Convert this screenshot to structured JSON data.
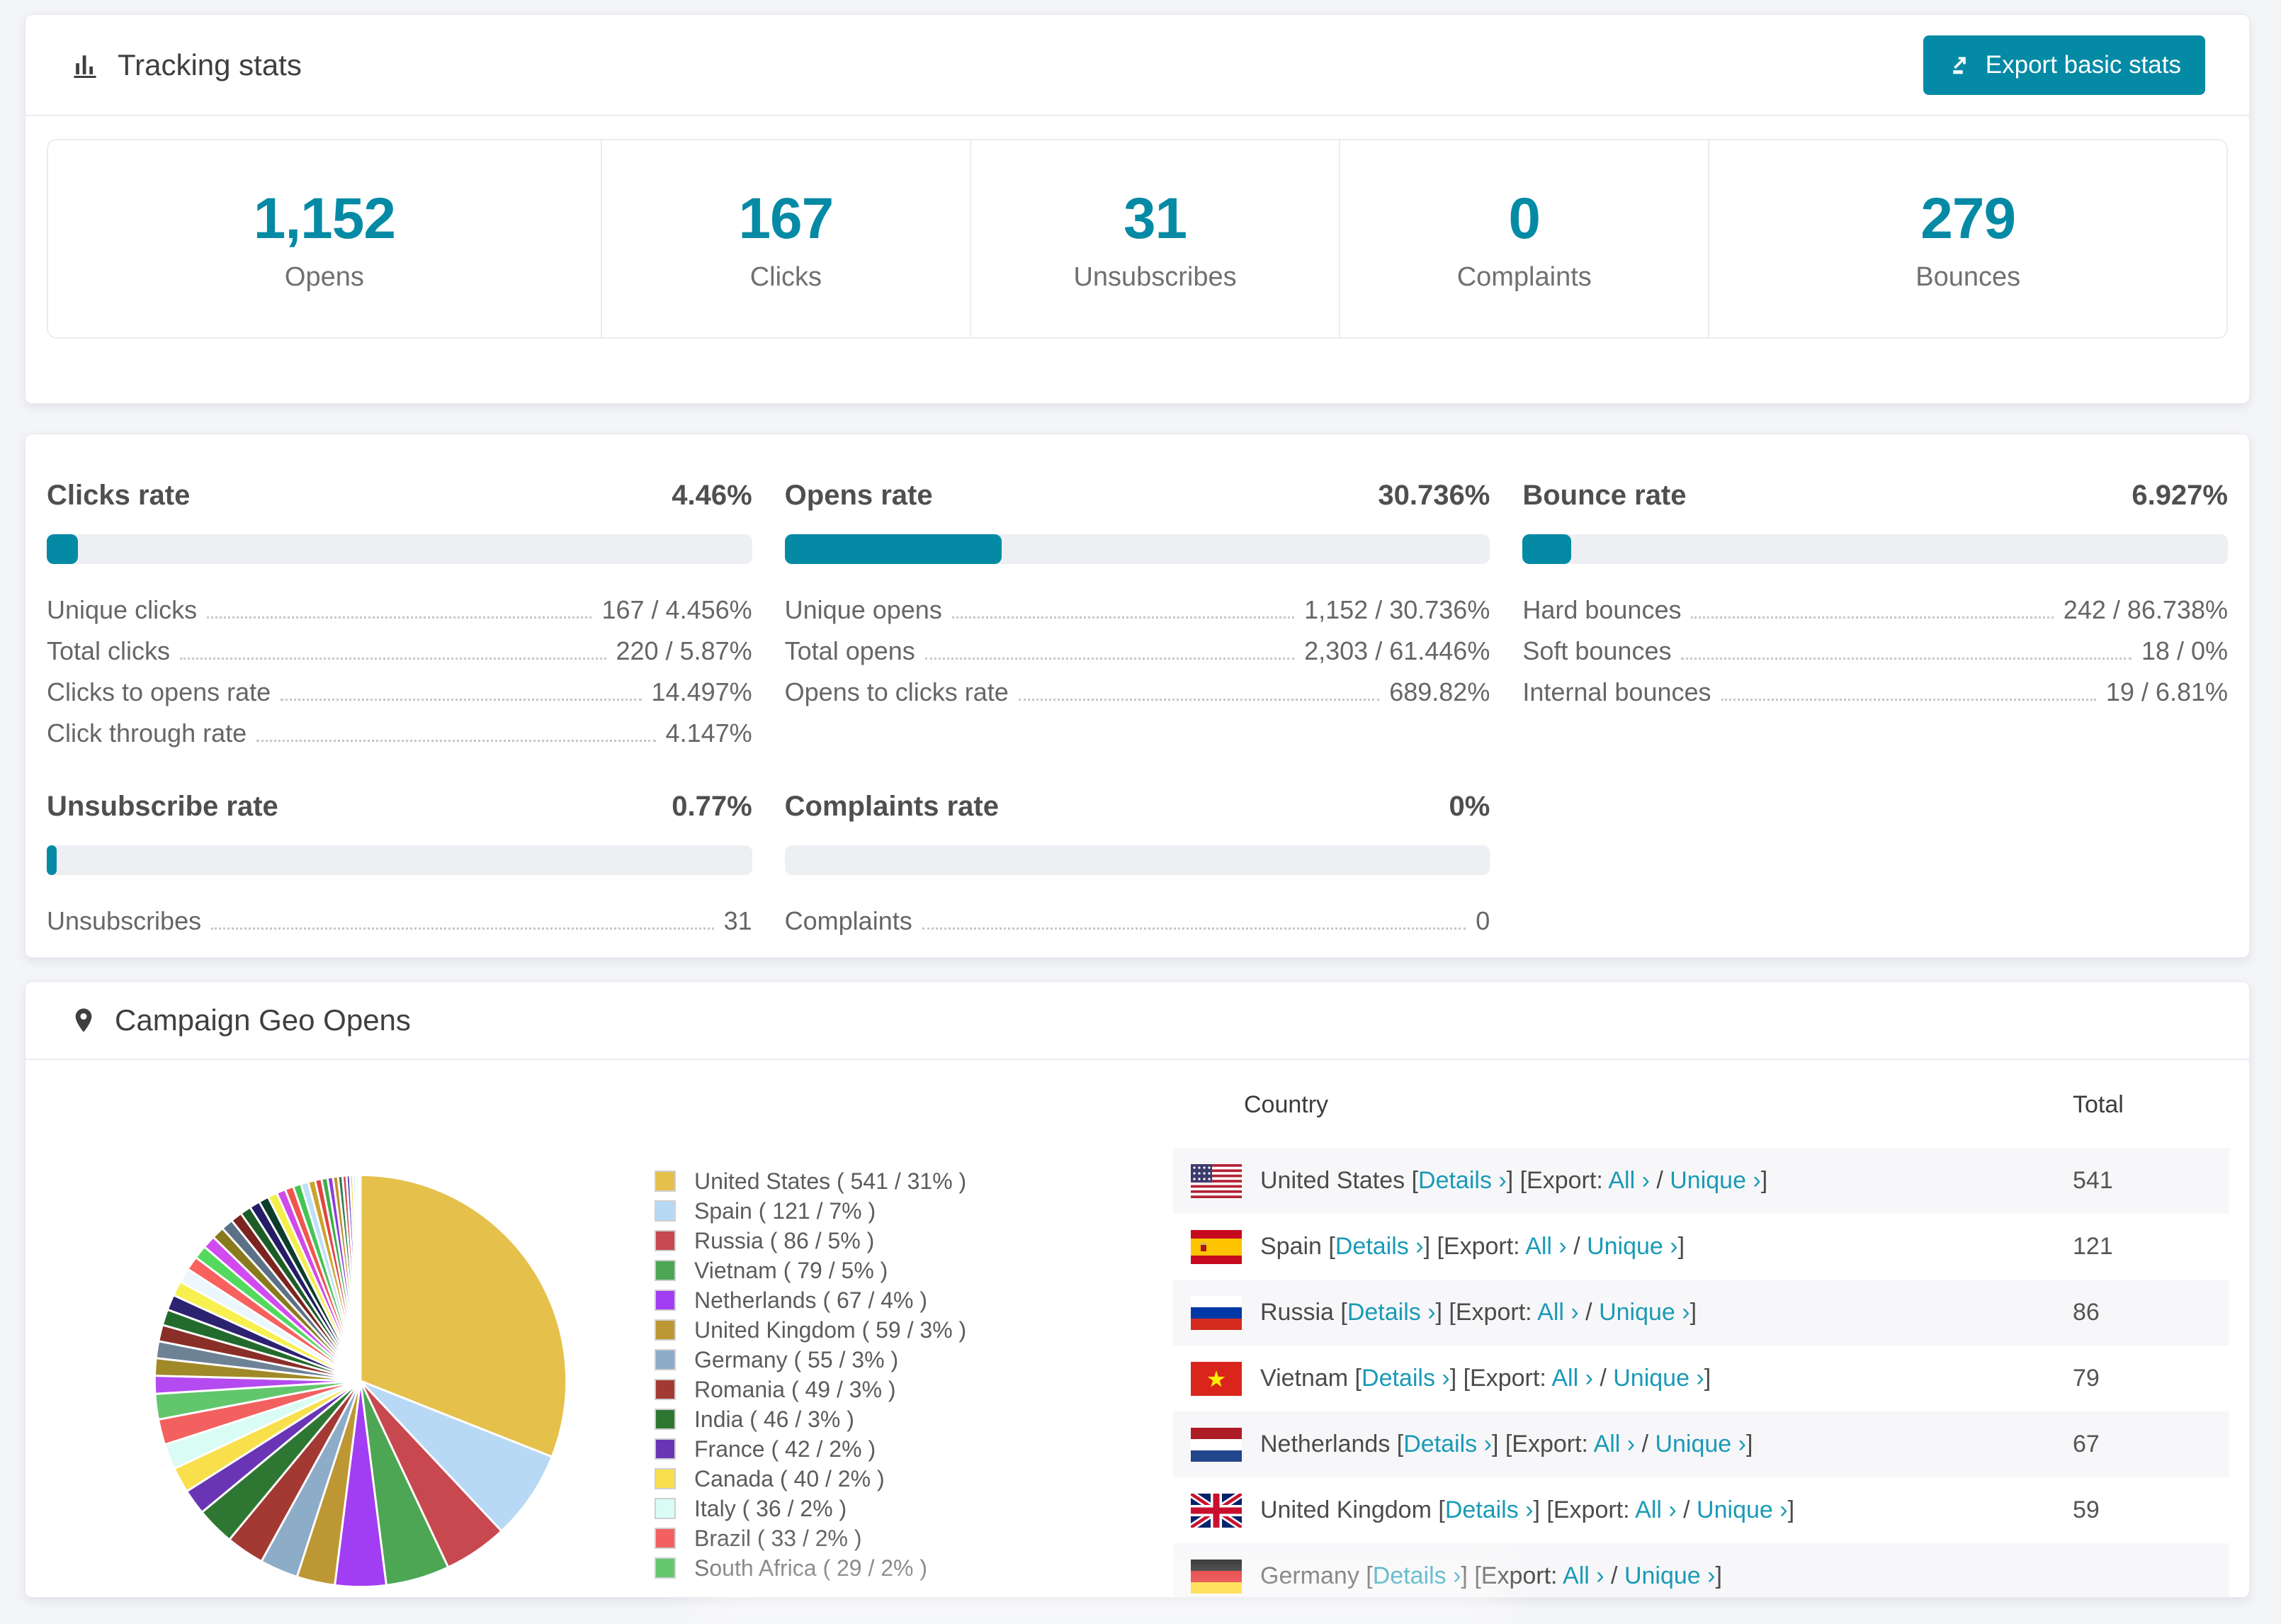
{
  "colors": {
    "accent": "#058aa5",
    "link": "#1a9ab6",
    "bar_track": "#edeff3",
    "page_background": "#f4f5f7",
    "row_stripe": "#f7f7f9"
  },
  "tracking": {
    "title": "Tracking stats",
    "export_button": "Export basic stats",
    "stats": [
      {
        "value": "1,152",
        "label": "Opens"
      },
      {
        "value": "167",
        "label": "Clicks"
      },
      {
        "value": "31",
        "label": "Unsubscribes"
      },
      {
        "value": "0",
        "label": "Complaints"
      },
      {
        "value": "279",
        "label": "Bounces"
      }
    ]
  },
  "rates": {
    "blocks": [
      {
        "title": "Clicks rate",
        "value": "4.46%",
        "pct": 4.46,
        "rows": [
          [
            "Unique clicks",
            "167 / 4.456%"
          ],
          [
            "Total clicks",
            "220 / 5.87%"
          ],
          [
            "Clicks to opens rate",
            "14.497%"
          ],
          [
            "Click through rate",
            "4.147%"
          ]
        ]
      },
      {
        "title": "Opens rate",
        "value": "30.736%",
        "pct": 30.736,
        "rows": [
          [
            "Unique opens",
            "1,152 / 30.736%"
          ],
          [
            "Total opens",
            "2,303 / 61.446%"
          ],
          [
            "Opens to clicks rate",
            "689.82%"
          ]
        ]
      },
      {
        "title": "Bounce rate",
        "value": "6.927%",
        "pct": 6.927,
        "rows": [
          [
            "Hard bounces",
            "242 / 86.738%"
          ],
          [
            "Soft bounces",
            "18 / 0%"
          ],
          [
            "Internal bounces",
            "19 / 6.81%"
          ]
        ]
      },
      {
        "title": "Unsubscribe rate",
        "value": "0.77%",
        "pct": 0.77,
        "rows": [
          [
            "Unsubscribes",
            "31"
          ]
        ]
      },
      {
        "title": "Complaints rate",
        "value": "0%",
        "pct": 0,
        "rows": [
          [
            "Complaints",
            "0"
          ]
        ]
      }
    ]
  },
  "geo": {
    "title": "Campaign Geo Opens",
    "chart_data": {
      "type": "pie",
      "title": "Campaign Geo Opens",
      "legend_position": "right-of-pie",
      "start_angle_deg": 0,
      "direction": "clockwise",
      "legend_format": "{name} ( {value} / {pct}% )",
      "series": [
        {
          "name": "United States",
          "value": 541,
          "pct": 31,
          "color": "#e5c04b",
          "flag": "us"
        },
        {
          "name": "Spain",
          "value": 121,
          "pct": 7,
          "color": "#b8d9f5",
          "flag": "es"
        },
        {
          "name": "Russia",
          "value": 86,
          "pct": 5,
          "color": "#c8484f",
          "flag": "ru"
        },
        {
          "name": "Vietnam",
          "value": 79,
          "pct": 5,
          "color": "#4da653",
          "flag": "vn"
        },
        {
          "name": "Netherlands",
          "value": 67,
          "pct": 4,
          "color": "#a13df2",
          "flag": "nl"
        },
        {
          "name": "United Kingdom",
          "value": 59,
          "pct": 3,
          "color": "#bd9733",
          "flag": "gb"
        },
        {
          "name": "Germany",
          "value": 55,
          "pct": 3,
          "color": "#8cacc8",
          "flag": "de"
        },
        {
          "name": "Romania",
          "value": 49,
          "pct": 3,
          "color": "#a23a33",
          "flag": "ro"
        },
        {
          "name": "India",
          "value": 46,
          "pct": 3,
          "color": "#2e7733",
          "flag": "in"
        },
        {
          "name": "France",
          "value": 42,
          "pct": 2,
          "color": "#6a35b5",
          "flag": "fr"
        },
        {
          "name": "Canada",
          "value": 40,
          "pct": 2,
          "color": "#f8e04d",
          "flag": "ca"
        },
        {
          "name": "Italy",
          "value": 36,
          "pct": 2,
          "color": "#d9fcf4",
          "flag": "it"
        },
        {
          "name": "Brazil",
          "value": 33,
          "pct": 2,
          "color": "#f2605f",
          "flag": "br"
        },
        {
          "name": "South Africa",
          "value": 29,
          "pct": 2,
          "color": "#62c66d",
          "flag": "za"
        }
      ],
      "other": {
        "total_pct": 26,
        "colors": [
          "#b44bf0",
          "#a08927",
          "#6e8296",
          "#8a2f28",
          "#236b2d",
          "#2c2270",
          "#f7f04e",
          "#ecf7fd",
          "#f8615e",
          "#52d95e",
          "#d24bf0",
          "#8a7a1e",
          "#5c7186",
          "#7c241e",
          "#1d5c26",
          "#241c66",
          "#0d3d2a",
          "#f3ee49",
          "#cf4ae8",
          "#f0564f",
          "#44c455",
          "#bfe0f6",
          "#cda32e",
          "#e24444",
          "#3fae4c",
          "#8c3ddb",
          "#c2912b",
          "#2f7d4f",
          "#d24b55",
          "#5a48c0",
          "#e8d84a",
          "#9fd0f0",
          "#c46a2a",
          "#7a2f66",
          "#3a6c8e",
          "#b8bf2e"
        ]
      }
    },
    "table": {
      "headers": [
        "Country",
        "Total"
      ],
      "export_prefix": "[Export:",
      "links": {
        "details": "Details ›",
        "all": "All ›",
        "unique": "Unique ›"
      },
      "rows": [
        {
          "country": "United States",
          "flag": "us",
          "total": "541"
        },
        {
          "country": "Spain",
          "flag": "es",
          "total": "121"
        },
        {
          "country": "Russia",
          "flag": "ru",
          "total": "86"
        },
        {
          "country": "Vietnam",
          "flag": "vn",
          "total": "79"
        },
        {
          "country": "Netherlands",
          "flag": "nl",
          "total": "67"
        },
        {
          "country": "United Kingdom",
          "flag": "gb",
          "total": "59"
        },
        {
          "country": "Germany",
          "flag": "de",
          "total": ""
        }
      ]
    }
  }
}
